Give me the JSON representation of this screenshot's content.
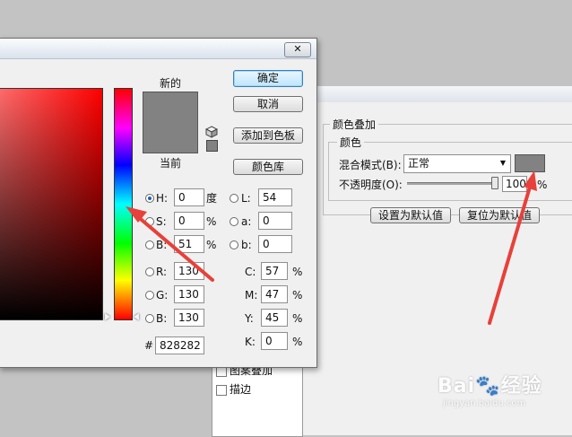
{
  "picker": {
    "close_glyph": "✕",
    "new_label": "新的",
    "current_label": "当前",
    "ok_button": "确定",
    "cancel_button": "取消",
    "add_swatch_button": "添加到色板",
    "color_library_button": "颜色库",
    "swatch_color": "#828282",
    "hsb": [
      {
        "key": "H:",
        "value": "0",
        "unit": "度",
        "checked": true
      },
      {
        "key": "S:",
        "value": "0",
        "unit": "%",
        "checked": false
      },
      {
        "key": "B:",
        "value": "51",
        "unit": "%",
        "checked": false
      }
    ],
    "rgb": [
      {
        "key": "R:",
        "value": "130"
      },
      {
        "key": "G:",
        "value": "130"
      },
      {
        "key": "B:",
        "value": "130"
      }
    ],
    "lab": [
      {
        "key": "L:",
        "value": "54"
      },
      {
        "key": "a:",
        "value": "0"
      },
      {
        "key": "b:",
        "value": "0"
      }
    ],
    "cmyk": [
      {
        "key": "C:",
        "value": "57",
        "unit": "%"
      },
      {
        "key": "M:",
        "value": "47",
        "unit": "%"
      },
      {
        "key": "Y:",
        "value": "45",
        "unit": "%"
      },
      {
        "key": "K:",
        "value": "0",
        "unit": "%"
      }
    ],
    "hex_label": "#",
    "hex_value": "828282"
  },
  "layer_style": {
    "section_title": "颜色叠加",
    "group_title": "颜色",
    "blend_label": "混合模式(B):",
    "blend_value": "正常",
    "opacity_label": "不透明度(O):",
    "opacity_value": "100",
    "opacity_unit": "%",
    "overlay_color": "#828282",
    "set_default_button": "设置为默认值",
    "reset_default_button": "复位为默认值",
    "list_items": [
      "图案叠加",
      "描边"
    ]
  },
  "watermark": {
    "brand": "Bai",
    "brand2": "经验",
    "url": "jingyan.baidu.com"
  }
}
